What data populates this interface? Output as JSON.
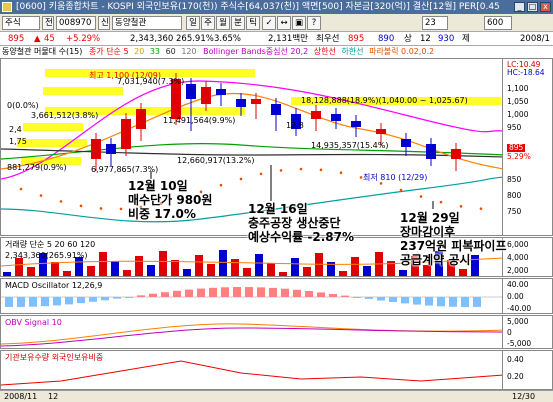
{
  "window": {
    "title": "[0600] 키움종합차트 - KOSPI 외국인보유(170(천)) 주식수[64,037(천)] 액면[500] 자본금[320(억)] 결산[12월] PER[0.45",
    "min_label": "_",
    "max_label": "□",
    "close_label": "x"
  },
  "toolbar": {
    "market": "주식",
    "search_label": "전",
    "code": "008970",
    "credit_label": "신",
    "stock_name": "동양철관",
    "period_buttons": [
      "일",
      "주",
      "월",
      "분",
      "틱"
    ],
    "tick_value": "23",
    "count_value": "600",
    "small_icons": [
      "✓",
      "↔",
      "▣",
      "?"
    ]
  },
  "quote": {
    "price": "895",
    "change_arrow": "▲",
    "change": "45",
    "change_rate": "+5.29%",
    "volume": "2,343,360",
    "volume_rate": "265.91%",
    "turnover": "3.65%",
    "amount": "2,131백만",
    "ask_label": "최우선",
    "ask": "895",
    "bid": "890",
    "lower": "상",
    "unit1": "12",
    "unit2": "930",
    "extra": "제",
    "date": "2008/1"
  },
  "legend": {
    "left": "동양철관 머물대 수(15)",
    "price_ma": "종가 단순 5",
    "ma20": "20",
    "ma33": "33",
    "ma60": "60",
    "ma120": "120",
    "bollinger": "Bollinger Bands중심선 20,2",
    "upper": "상한선",
    "lower": "하한선",
    "parabolic": "파라볼릭 0.02,0.2",
    "lc": "LC:10.49",
    "hc": "HC:-18.64"
  },
  "price_panel": {
    "high_label": "최고 1,100 (12/09)",
    "low_label": "최저 810 (12/29)",
    "vol_labels": [
      "7,031,940(7.3%)",
      "3,661,512(3.8%)",
      "11,491,564(9.9%)",
      "18,128,888(18.9%)(1,040.00 ~ 1,025.67)",
      "12,8",
      "14,935,357(15.4%)",
      "0(0.0%)",
      "6,977,865(7.3%)",
      "881,279(0.9%)",
      "2,4",
      "1,75",
      "12,660,917(13.2%)"
    ],
    "axis": [
      "1,100",
      "1,050",
      "1,000",
      "950",
      "895",
      "5.29%",
      "850",
      "800",
      "750"
    ]
  },
  "annotations": {
    "a1_line1": "12월 10일",
    "a1_line2": "매수단가 980원",
    "a1_line3": "비중 17.0%",
    "a2_line1": "12월 16일",
    "a2_line2": "충주공장 생산중단",
    "a2_line3": "예상수익률 -2.87%",
    "a3_line1": "12월 29일",
    "a3_line2": "장마감이후",
    "a3_line3": "237억원 피복파이프",
    "a3_line4": "공급계약 공시"
  },
  "volume_panel": {
    "legend": "거래량 단순 5 20 60 120",
    "value": "2,343,360(265.91%)",
    "axis": [
      "6,000",
      "4,000",
      "2,000"
    ]
  },
  "macd_panel": {
    "legend": "MACD Oscillator 12,26,9",
    "axis": [
      "40.00",
      "0.00",
      "-40.00"
    ]
  },
  "obv_panel": {
    "legend": "OBV Signal 10",
    "axis": [
      "5,000",
      "0",
      "-5,000"
    ]
  },
  "inst_panel": {
    "legend": "기관보유수량  외국인보유비중",
    "axis": [
      "0.40",
      "0.20"
    ]
  },
  "bottom": {
    "left": "2008/11",
    "mid": "12",
    "right": "12/30"
  },
  "colors": {
    "up": "#e00000",
    "down": "#0000d0",
    "upper_band": "#ff00ff",
    "lower_band": "#00a0a0",
    "ma5": "#ff7f00",
    "ma20": "#00a000",
    "ma60": "#303030",
    "highlight": "#ffff00"
  }
}
